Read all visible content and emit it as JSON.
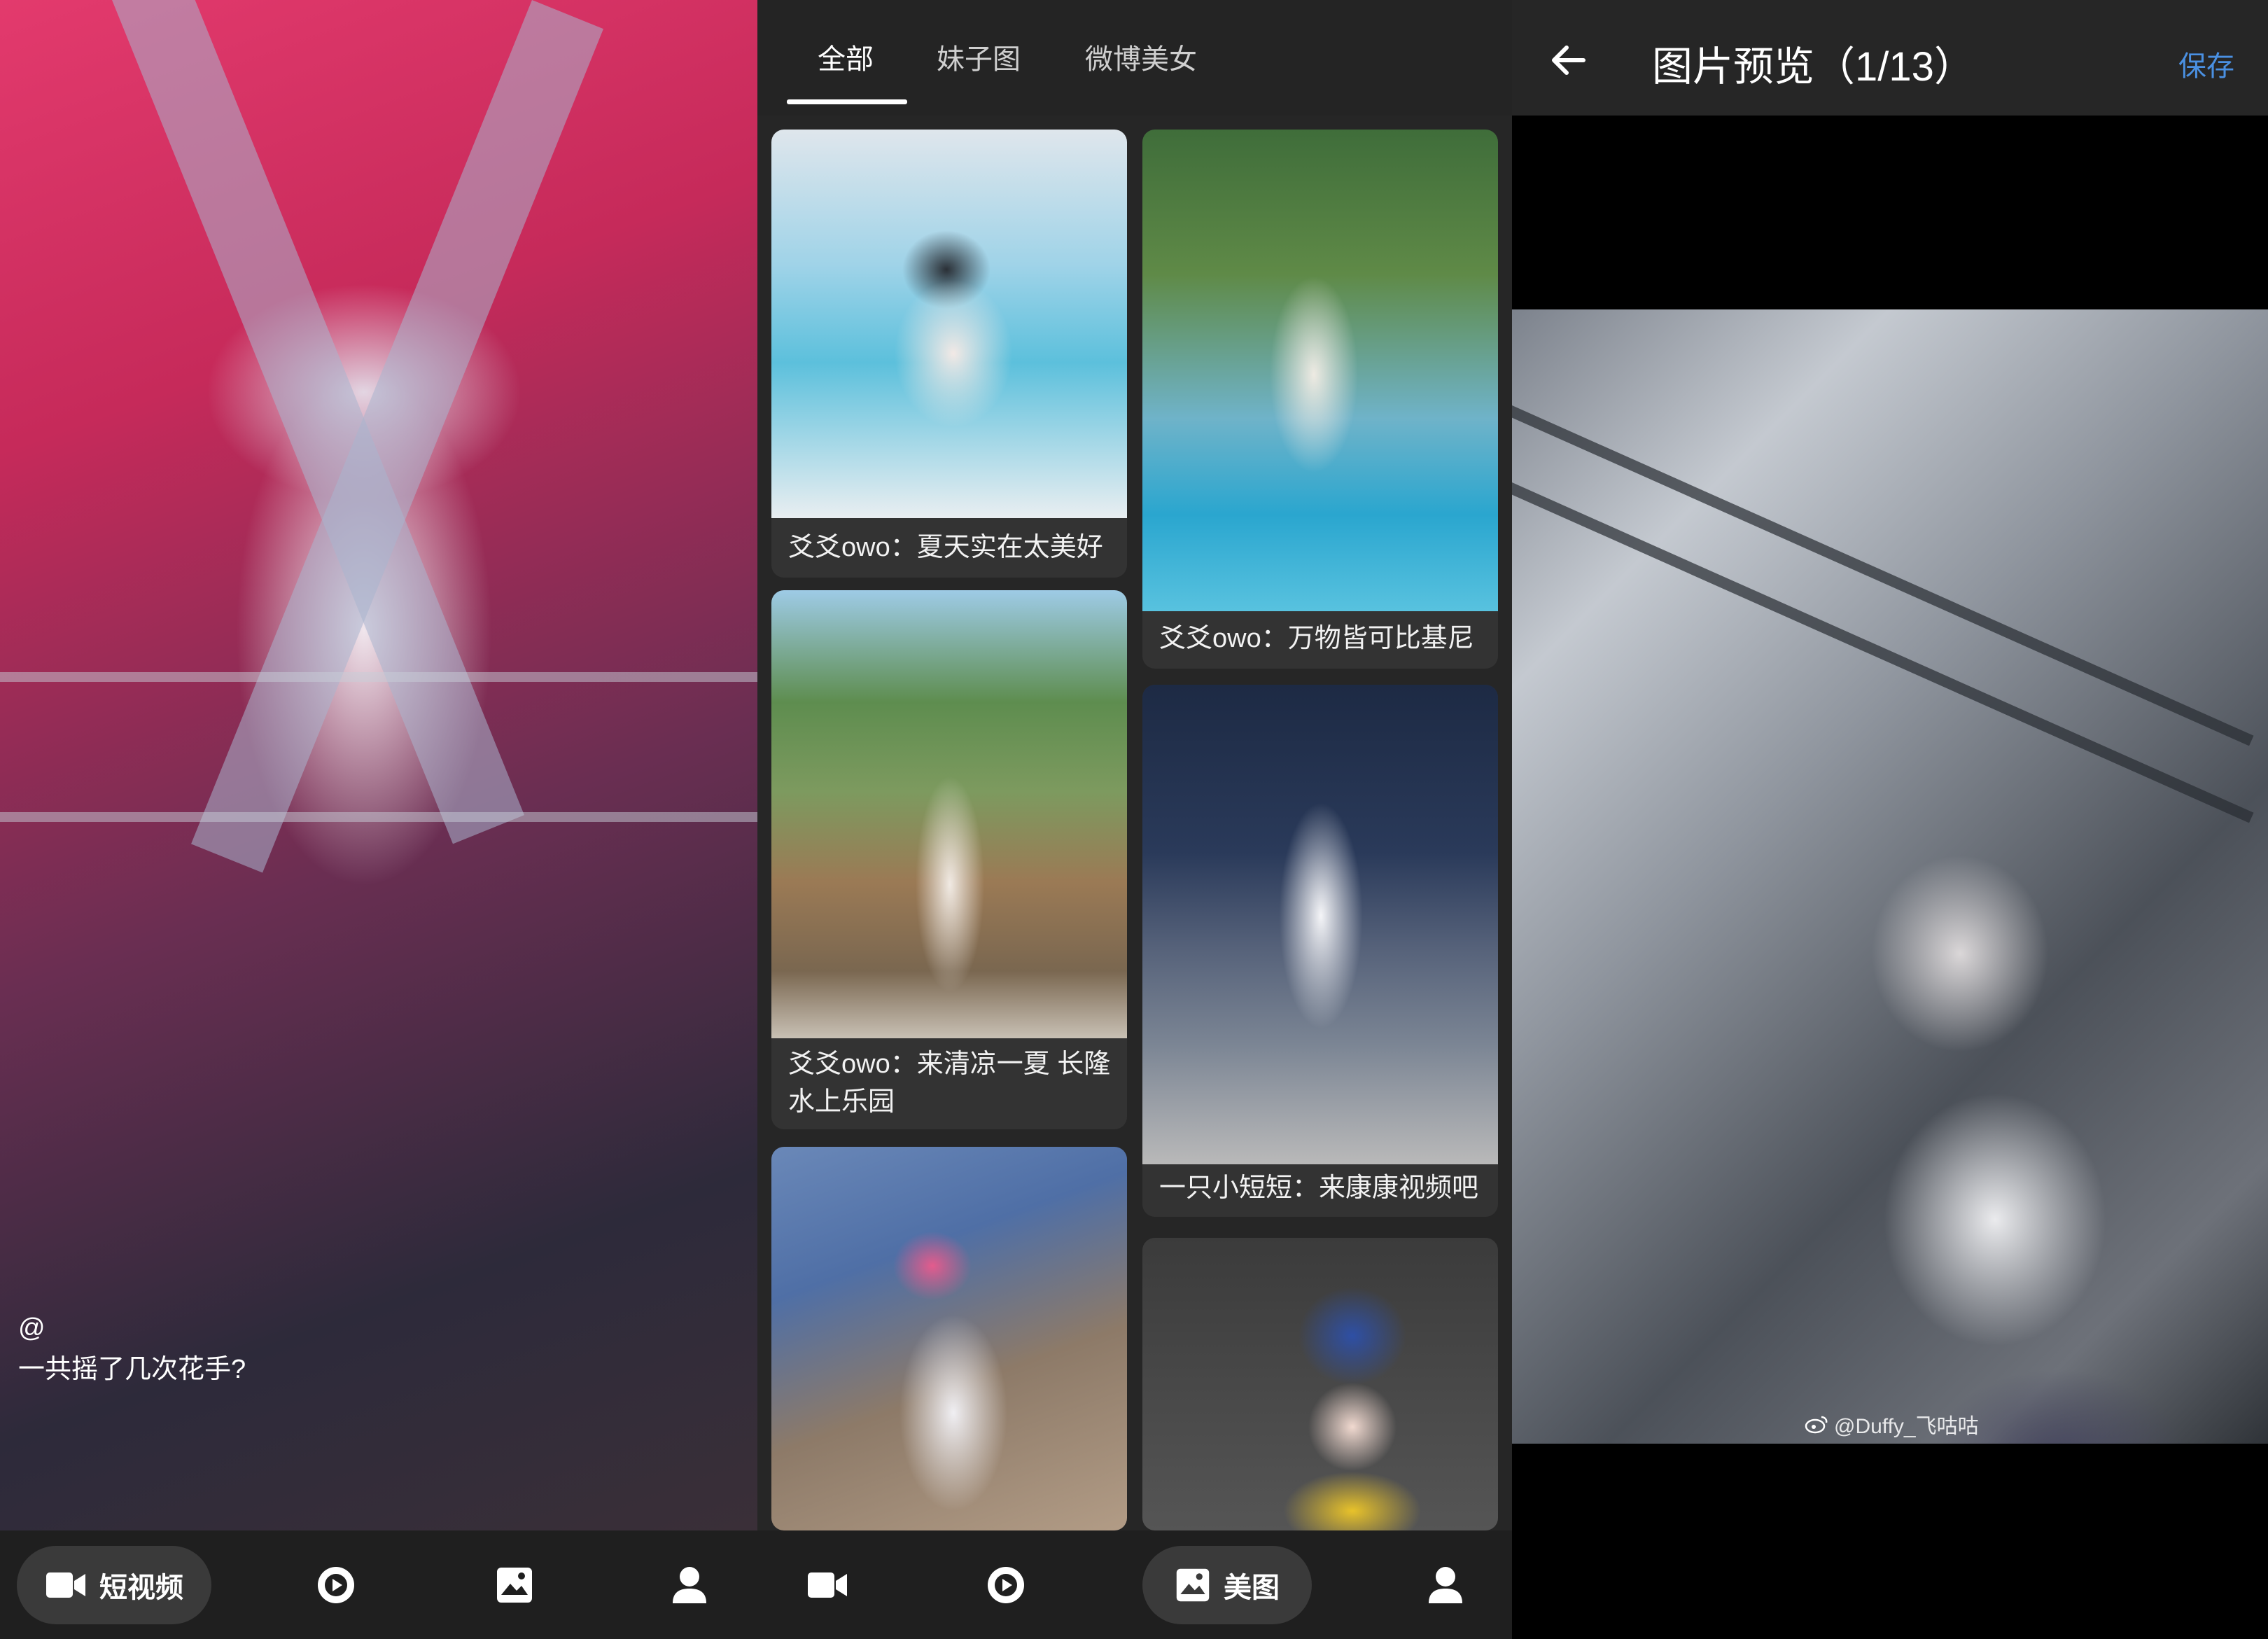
{
  "video_screen": {
    "caption_author": "@",
    "caption_text": "一共摇了几次花手?",
    "nav": [
      {
        "label": "短视频",
        "icon": "video-camera-icon",
        "active": true
      },
      {
        "label": "",
        "icon": "play-circle-icon",
        "active": false
      },
      {
        "label": "",
        "icon": "image-icon",
        "active": false
      },
      {
        "label": "",
        "icon": "person-icon",
        "active": false
      }
    ]
  },
  "feed_screen": {
    "tabs": [
      {
        "label": "全部",
        "active": true
      },
      {
        "label": "妹子图",
        "active": false
      },
      {
        "label": "微博美女",
        "active": false
      }
    ],
    "cards": [
      {
        "caption": "爻爻owo：夏天实在太美好",
        "scene": "pool-portrait"
      },
      {
        "caption": "爻爻owo：万物皆可比基尼",
        "scene": "pool-garden"
      },
      {
        "caption": "爻爻owo：来清凉一夏 长隆水上乐园",
        "scene": "park-fence"
      },
      {
        "caption": "一只小短短：来康康视频吧",
        "scene": "living-room"
      },
      {
        "caption": "",
        "scene": "cosplay-rocks"
      },
      {
        "caption": "",
        "scene": "cosplay-yellow"
      }
    ],
    "nav": [
      {
        "label": "",
        "icon": "video-camera-icon",
        "active": false
      },
      {
        "label": "",
        "icon": "play-circle-icon",
        "active": false
      },
      {
        "label": "美图",
        "icon": "image-icon",
        "active": true
      },
      {
        "label": "",
        "icon": "person-icon",
        "active": false
      }
    ]
  },
  "preview_screen": {
    "title": "图片预览（1/13）",
    "save_label": "保存",
    "watermark": "@Duffy_飞咕咕",
    "accent_color": "#4a90e2"
  }
}
